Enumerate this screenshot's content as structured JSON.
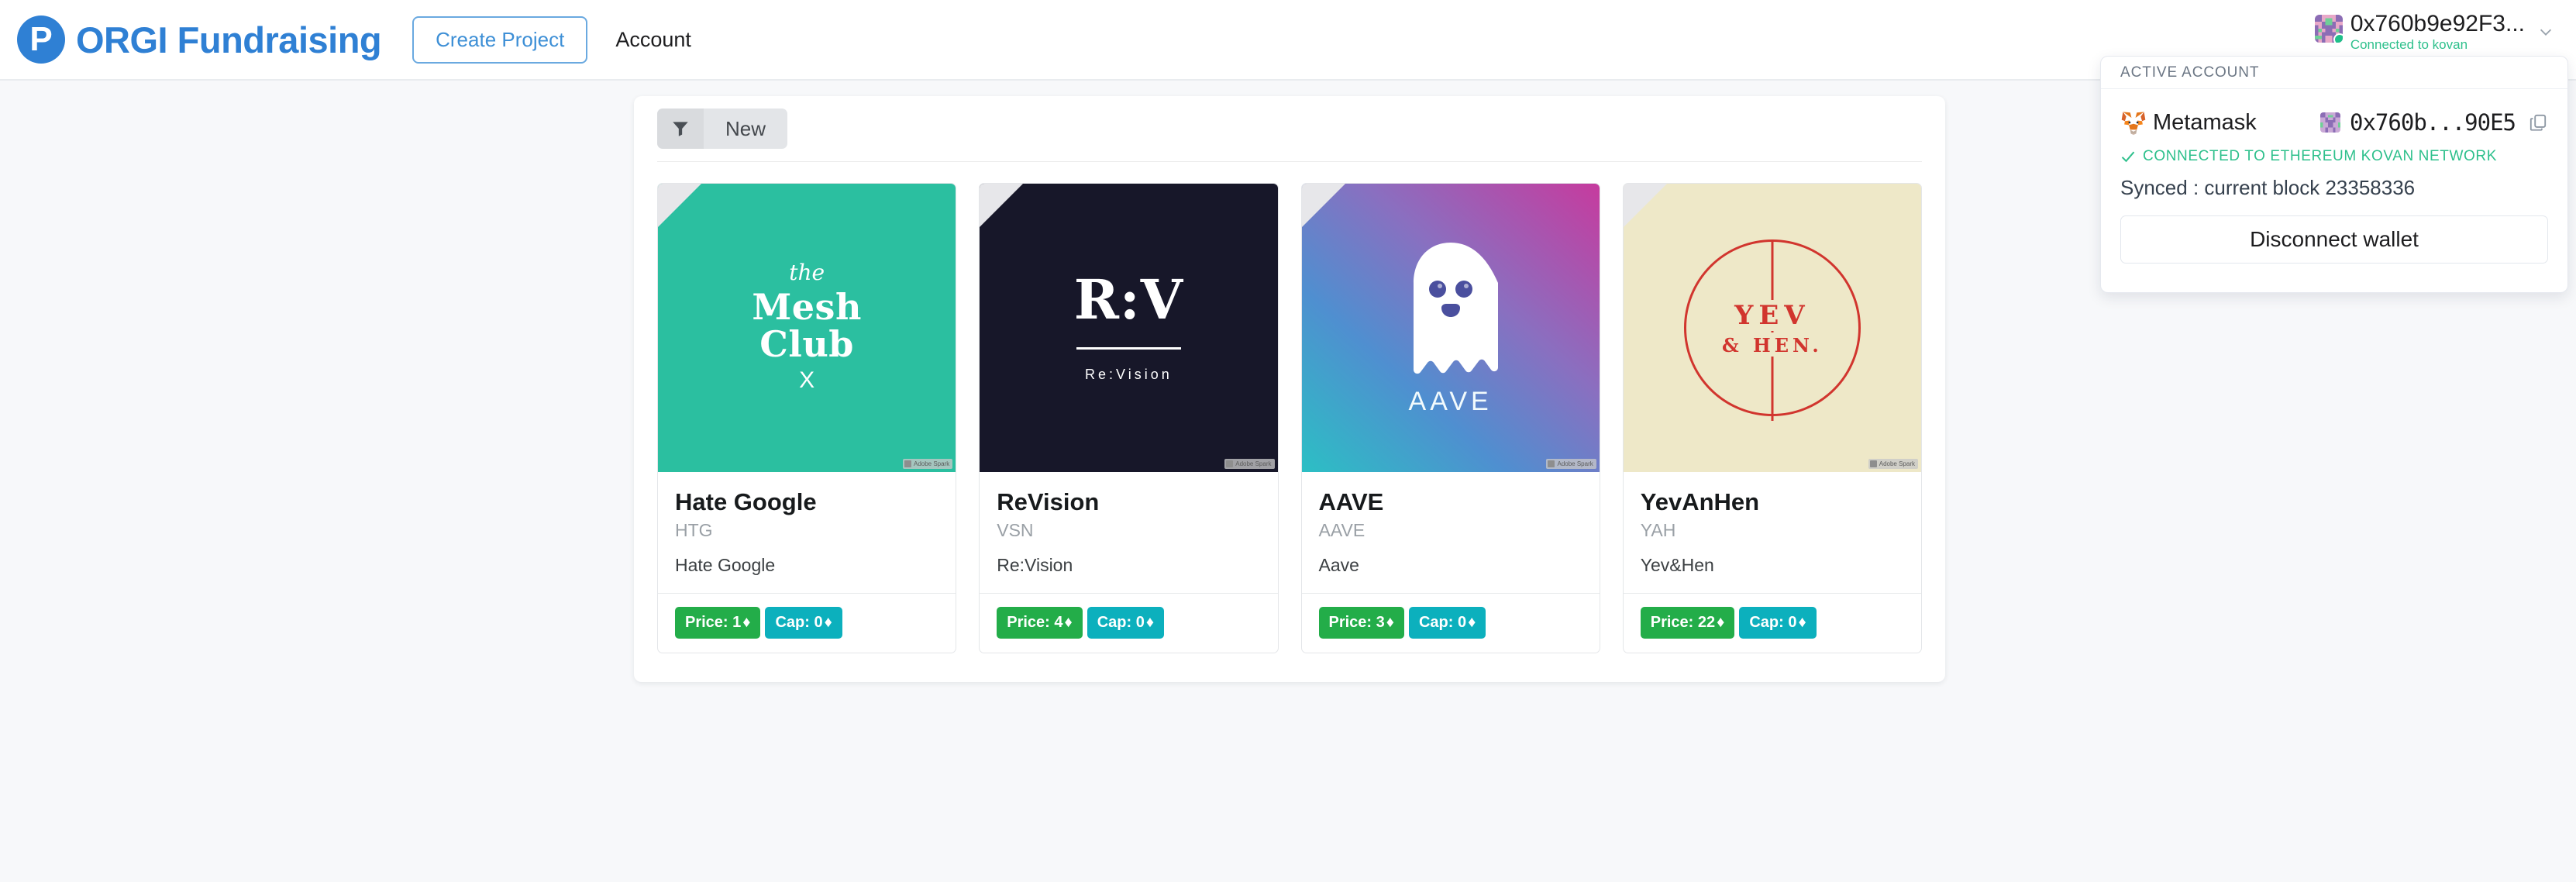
{
  "brand": {
    "mark_letter": "P",
    "name": "ORGI Fundraising",
    "accent": "#2f80d4"
  },
  "nav": {
    "create_project_label": "Create Project",
    "account_label": "Account"
  },
  "account": {
    "address_short": "0x760b9e92F3...",
    "network_status": "Connected to kovan",
    "chevron_icon": "chevron-down-icon",
    "panel": {
      "header": "ACTIVE ACCOUNT",
      "wallet_name": "Metamask",
      "wallet_icon": "metamask-fox-icon",
      "wallet_address": "0x760b...90E5",
      "copy_icon": "copy-icon",
      "network_check_icon": "check-icon",
      "network_text": "CONNECTED TO ETHEREUM KOVAN NETWORK",
      "network_color": "#2ec08c",
      "sync_text": "Synced  : current block 23358336",
      "disconnect_label": "Disconnect wallet"
    }
  },
  "toolbar": {
    "filter_icon": "filter-icon",
    "new_label": "New"
  },
  "cards": [
    {
      "title": "Hate Google",
      "symbol": "HTG",
      "description": "Hate Google",
      "price_label": "Price: 1",
      "cap_label": "Cap: 0",
      "currency_glyph": "♦",
      "price_color": "#23ad49",
      "cap_color": "#0cb0bd",
      "watermark": "Adobe Spark",
      "art": {
        "kind": "mesh-club",
        "bg": "#2bbfa0",
        "line1": "the",
        "line2": "Mesh",
        "line3": "Club",
        "line4": "X"
      }
    },
    {
      "title": "ReVision",
      "symbol": "VSN",
      "description": "Re:Vision",
      "price_label": "Price: 4",
      "cap_label": "Cap: 0",
      "currency_glyph": "♦",
      "price_color": "#23ad49",
      "cap_color": "#0cb0bd",
      "watermark": "Adobe Spark",
      "art": {
        "kind": "revision",
        "bg": "#171729",
        "line1": "R:V",
        "line2": "Re:Vision"
      }
    },
    {
      "title": "AAVE",
      "symbol": "AAVE",
      "description": "Aave",
      "price_label": "Price: 3",
      "cap_label": "Cap: 0",
      "currency_glyph": "♦",
      "price_color": "#23ad49",
      "cap_color": "#0cb0bd",
      "watermark": "Adobe Spark",
      "art": {
        "kind": "aave-ghost",
        "gradient_from": "#2cbfc4",
        "gradient_to": "#c63b9e",
        "line1": "AAVE"
      }
    },
    {
      "title": "YevAnHen",
      "symbol": "YAH",
      "description": "Yev&Hen",
      "price_label": "Price: 22",
      "cap_label": "Cap: 0",
      "currency_glyph": "♦",
      "price_color": "#23ad49",
      "cap_color": "#0cb0bd",
      "watermark": "Adobe Spark",
      "art": {
        "kind": "yev-hen",
        "bg": "#eee8c8",
        "ink": "#d1352e",
        "line1": "YEV",
        "line2": "& HEN."
      }
    }
  ]
}
